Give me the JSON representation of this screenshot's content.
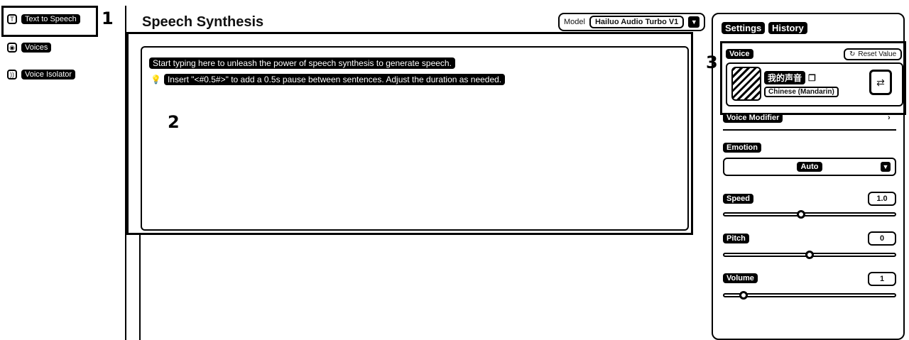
{
  "callouts": [
    "1",
    "2",
    "3"
  ],
  "sidebar": {
    "items": [
      {
        "label": "Text to Speech",
        "icon": "text-icon"
      },
      {
        "label": "Voices",
        "icon": "voices-icon"
      },
      {
        "label": "Voice Isolator",
        "icon": "voice-isolator-icon"
      }
    ]
  },
  "main": {
    "title": "Speech Synthesis",
    "model_label": "Model",
    "model_value": "Hailuo Audio Turbo V1",
    "placeholder": "Start typing here to unleash the power of speech synthesis to generate speech.",
    "hint": "Insert \"<#0.5#>\" to add a 0.5s pause between sentences. Adjust the duration as needed."
  },
  "settings": {
    "tabs": [
      "Settings",
      "History"
    ],
    "voice_label": "Voice",
    "reset_label": "Reset Value",
    "voice_name": "我的声音",
    "voice_language": "Chinese (Mandarin)",
    "modifier_label": "Voice Modifier",
    "emotion_label": "Emotion",
    "emotion_value": "Auto",
    "speed_label": "Speed",
    "speed_value": "1.0",
    "speed_level": 0.45,
    "pitch_label": "Pitch",
    "pitch_value": "0",
    "pitch_level": 0.5,
    "volume_label": "Volume",
    "volume_value": "1",
    "volume_level": 0.1
  }
}
